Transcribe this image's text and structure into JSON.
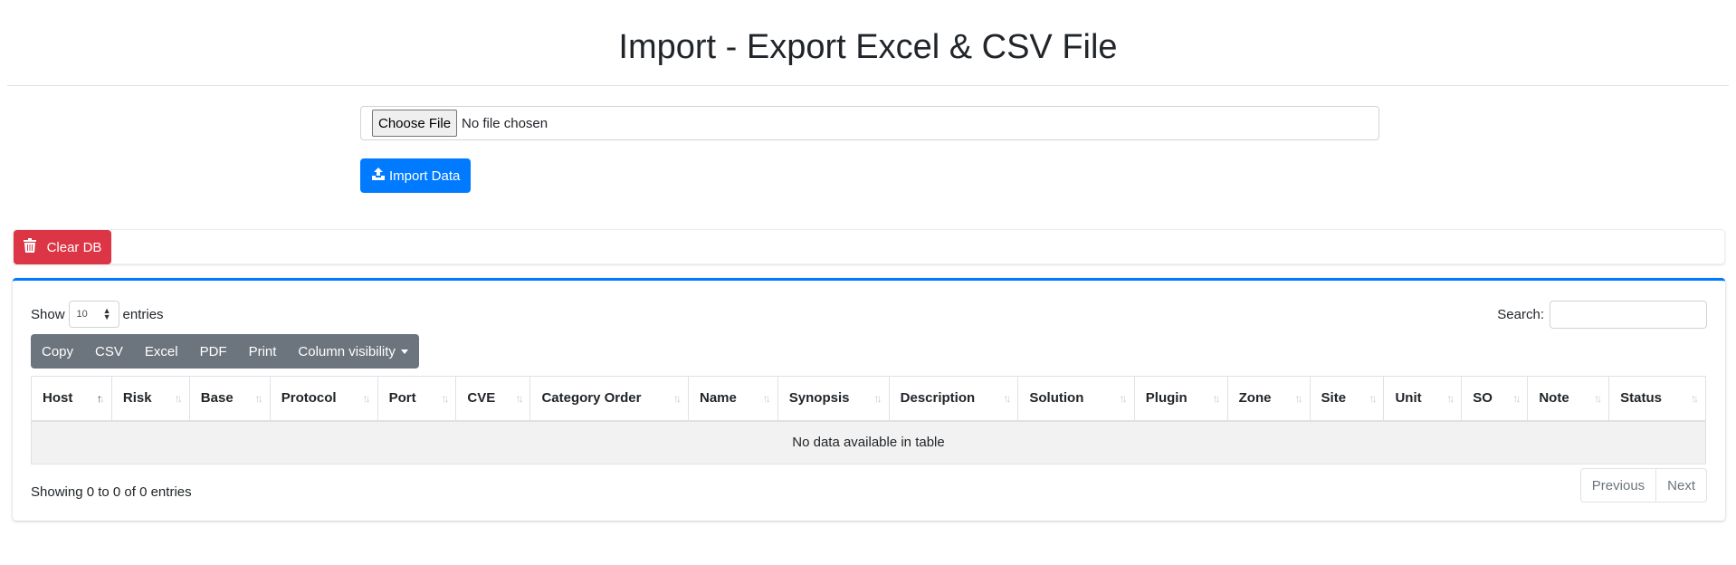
{
  "header": {
    "title": "Import - Export Excel & CSV File"
  },
  "import": {
    "file_button_label": "Choose File",
    "file_status": "No file chosen",
    "import_button_label": "Import Data",
    "import_icon": "upload-icon"
  },
  "clear": {
    "label": "Clear DB",
    "icon": "trash-icon"
  },
  "table_controls": {
    "show_label": "Show",
    "entries_label": "entries",
    "page_length": "10",
    "search_label": "Search:",
    "search_value": "",
    "buttons": [
      "Copy",
      "CSV",
      "Excel",
      "PDF",
      "Print",
      "Column visibility"
    ]
  },
  "table": {
    "columns": [
      "Host",
      "Risk",
      "Base",
      "Protocol",
      "Port",
      "CVE",
      "Category Order",
      "Name",
      "Synopsis",
      "Description",
      "Solution",
      "Plugin",
      "Zone",
      "Site",
      "Unit",
      "SO",
      "Note",
      "Status"
    ],
    "sorted_column": "Host",
    "sort_direction": "asc",
    "empty_message": "No data available in table"
  },
  "footer": {
    "info": "Showing 0 to 0 of 0 entries",
    "previous_label": "Previous",
    "next_label": "Next"
  },
  "colors": {
    "primary": "#007bff",
    "danger": "#dc3545",
    "secondary": "#6c757d"
  }
}
